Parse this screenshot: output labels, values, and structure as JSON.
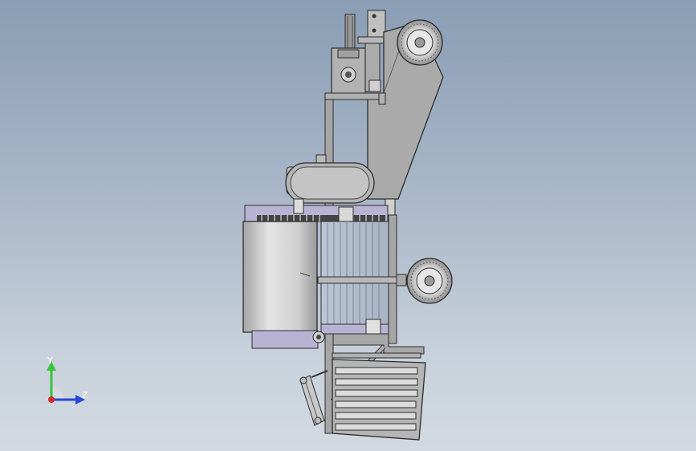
{
  "viewport": {
    "background_top": "#8a9db4",
    "background_bottom": "#d2d9e1",
    "model_colors": {
      "frame": "#a9a9a9",
      "edge": "#2b2b2b",
      "drum": "#d6d6d6",
      "drum_shadow": "#9d9d9d",
      "tire": "#cfcfcf",
      "purple_tint": "#b9b3d3"
    }
  },
  "triad": {
    "y_label": "Y",
    "z_label": "Z",
    "y_color": "#3cc23c",
    "z_color": "#2846d8",
    "x_color": "#d82828"
  }
}
